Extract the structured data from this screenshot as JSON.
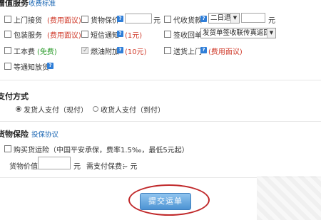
{
  "value_added": {
    "title": "增值服务",
    "fee_link": "收费标准",
    "pickup": {
      "label": "上门接货",
      "note": "(费用面议)"
    },
    "goods_insured": {
      "label": "货物保价",
      "unit": "元"
    },
    "cod": {
      "label": "代收货款",
      "select": "二日退",
      "unit": "元"
    },
    "packing": {
      "label": "包装服务",
      "note": "(费用面议)"
    },
    "sms": {
      "label": "短信通知",
      "note": "(1元)"
    },
    "receipt": {
      "label": "签收回单",
      "select": "发货单签收联传真返回"
    },
    "workday": {
      "label": "工本费",
      "note": "(免费)"
    },
    "fuel": {
      "label": "燃油附加",
      "note": "(10元)"
    },
    "delivery": {
      "label": "送货上门",
      "note": "(费用面议)"
    },
    "wait_notify": {
      "label": "等通知放货"
    },
    "help_glyph": "?"
  },
  "payment": {
    "title": "支付方式",
    "options": [
      "发货人支付（现付）",
      "收货人支付（到付）"
    ]
  },
  "insurance": {
    "title": "货物保险",
    "agreement_link": "投保协议",
    "buy_label": "购买货运险（中国平安承保，费率1.5‰，最低5元起）",
    "value_label": "货物价值",
    "value_unit": "元",
    "premium_label": "需支付保费：",
    "premium_value": "~ 元"
  },
  "submit_label": "提交运单",
  "colors": {
    "accent": "#2f7ed8",
    "fee_red": "#d03a2a",
    "free_green": "#2c9b2c",
    "circle": "#c0282a"
  }
}
